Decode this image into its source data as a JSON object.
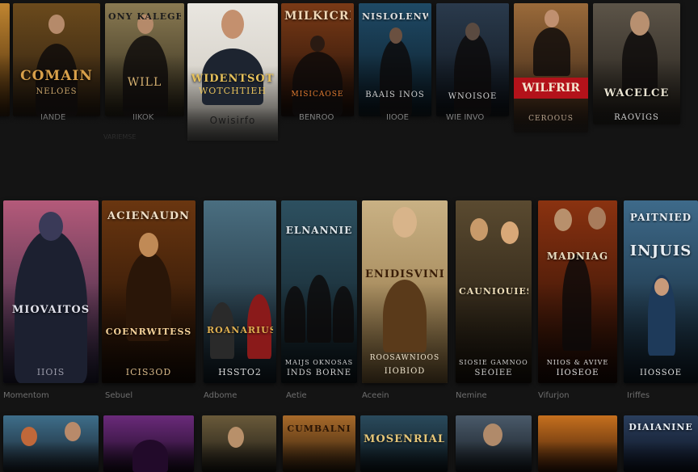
{
  "row1": {
    "cards": [
      {
        "title": "COMAIN",
        "subtitle": "NELOES",
        "caption": "IANDE",
        "colors": [
          "#6b4a1c",
          "#2a1d10"
        ]
      },
      {
        "title": "ONY KALEGE",
        "subtitle": "WILL",
        "caption": "IIKOK",
        "colors": [
          "#8a7a52",
          "#2b2618"
        ]
      },
      {
        "title": "WIDENTSOT",
        "subtitle": "WOTCHTIEH",
        "caption": "Owisirfo",
        "colors": [
          "#e9e6e0",
          "#c9c4ba"
        ]
      },
      {
        "title": "MILKICRIE",
        "subtitle": "MISICAOSE",
        "caption": "BENROO",
        "colors": [
          "#7a3a16",
          "#1d0e08"
        ]
      },
      {
        "title": "NISLOLENWE",
        "subtitle": "BAAIS INOS",
        "caption": "IIOOE",
        "colors": [
          "#1f4a66",
          "#0b1a24"
        ]
      },
      {
        "title": "",
        "subtitle": "WNOISOE",
        "caption": "WIE INVO",
        "colors": [
          "#2a3a4c",
          "#0e141c"
        ]
      },
      {
        "title": "WILFRIR",
        "subtitle": "",
        "caption": "CEROOUS",
        "colors": [
          "#9a6a3a",
          "#2a1a10"
        ]
      },
      {
        "title": "WACELCE",
        "subtitle": "",
        "caption": "RAOVIGS",
        "colors": [
          "#5c5448",
          "#211d18"
        ]
      }
    ],
    "small_label": "VARIEMSE"
  },
  "row2": {
    "cards": [
      {
        "title": "MIOVAITOS",
        "subtitle": "IIOIS",
        "caption": "Momentom",
        "colors": [
          "#b45a7a",
          "#22203a"
        ]
      },
      {
        "title": "ACIENAUDN",
        "subtitle": "ICIS3OD",
        "caption": "Sebuel",
        "colors": [
          "#6a3610",
          "#1a0c04"
        ],
        "title2": "COENRWITESS"
      },
      {
        "title": "ROANARIUSS",
        "subtitle": "HSSTO2",
        "caption": "Adbome",
        "colors": [
          "#4a6e80",
          "#13202a"
        ]
      },
      {
        "title": "ELNANNIE",
        "subtitle": "INDS BORNE",
        "caption": "Aetie",
        "colors": [
          "#2d5060",
          "#0f1a20"
        ],
        "title2": "MAIJS OKNOSAS"
      },
      {
        "title": "ENIDISVINIS",
        "subtitle": "IIOBIOD",
        "caption": "Aceein",
        "colors": [
          "#c9b184",
          "#8b6d3e"
        ],
        "title2": "ROOSAWNIOOS"
      },
      {
        "title": "CAUNIOUIES",
        "subtitle": "SEOIEE",
        "caption": "Nemine",
        "colors": [
          "#5a4a30",
          "#1a140c"
        ],
        "title2": "SIOSIE GAMNOOS"
      },
      {
        "title": "MADNIAG",
        "subtitle": "IIOSEOE",
        "caption": "Vifurjon",
        "colors": [
          "#8a3210",
          "#1c0a04"
        ],
        "title2": "NIIOS & AVIVE"
      },
      {
        "title": "PAITNIED",
        "subtitle": "IIOSSOE",
        "caption": "Iriffes",
        "colors": [
          "#3e6a8a",
          "#0f1e2a"
        ],
        "title2": "INJUIS"
      }
    ]
  },
  "row3": {
    "cards": [
      {
        "title": "",
        "colors": [
          "#3e6e8a",
          "#18202a"
        ]
      },
      {
        "title": "",
        "colors": [
          "#6a2a7a",
          "#1a0a20"
        ]
      },
      {
        "title": "",
        "colors": [
          "#6a5a3a",
          "#1c1a14"
        ]
      },
      {
        "title": "CUMBALNI",
        "colors": [
          "#a86a2a",
          "#2a1a0a"
        ]
      },
      {
        "title": "MOSENRIAL",
        "colors": [
          "#2a4a5c",
          "#0c161c"
        ]
      },
      {
        "title": "",
        "colors": [
          "#4a5a6a",
          "#141a20"
        ]
      },
      {
        "title": "",
        "colors": [
          "#c6701e",
          "#3a1a08"
        ]
      },
      {
        "title": "DIAIANINE",
        "colors": [
          "#2a3e5c",
          "#0c1220"
        ]
      }
    ]
  }
}
